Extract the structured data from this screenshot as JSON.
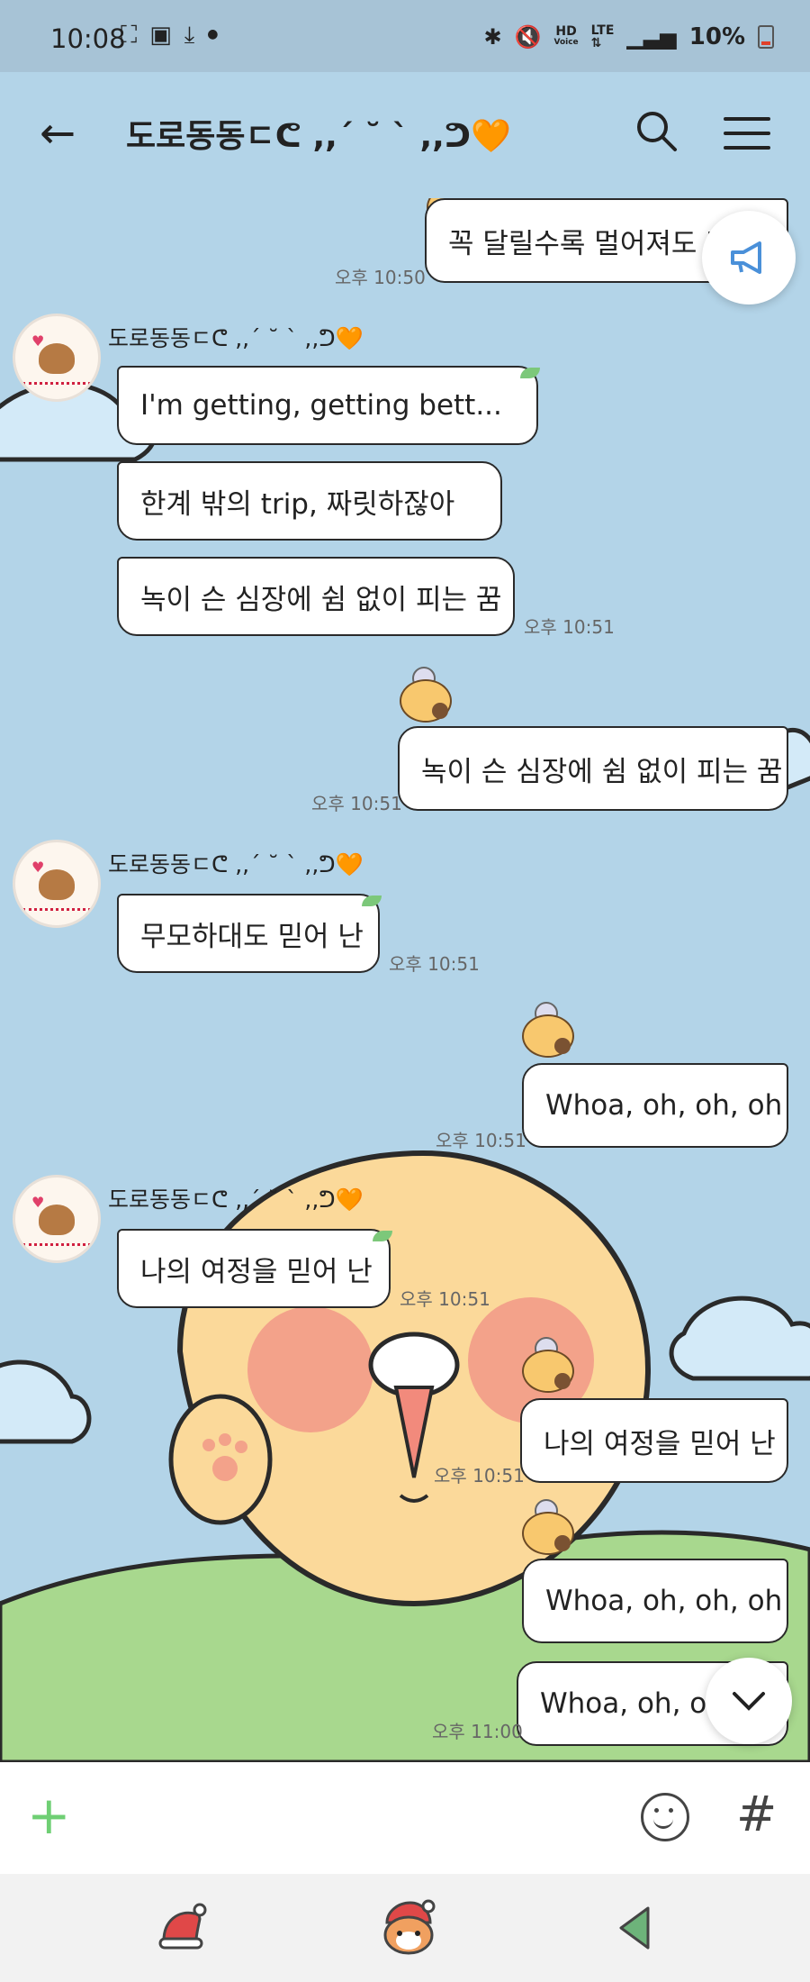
{
  "status_bar": {
    "time": "10:08",
    "icons_left": [
      "screenshot-icon",
      "image-icon",
      "download-icon",
      "dot-icon"
    ],
    "hd_label": "HD",
    "voice_label": "Voice",
    "lte_label": "LTE",
    "battery_text": "10%"
  },
  "header": {
    "title": "도로동동ㄷᕦ ,,ˊ ˘ ˋ ,,ᕤ🧡"
  },
  "messages": [
    {
      "id": "m0",
      "dir": "out",
      "text": "꼭 달릴수록 멀어져도 난",
      "time": "오후 10:50"
    },
    {
      "id": "m1",
      "dir": "in",
      "sender": "도로동동ㄷᕦ ,,ˊ ˘ ˋ ,,ᕤ🧡",
      "text": "I'm getting, getting bett...",
      "time": ""
    },
    {
      "id": "m2",
      "dir": "in",
      "text": "한계 밖의 trip, 짜릿하잖아",
      "time": ""
    },
    {
      "id": "m3",
      "dir": "in",
      "text": "녹이 슨 심장에 쉼 없이 피는 꿈",
      "time": "오후 10:51"
    },
    {
      "id": "m4",
      "dir": "out",
      "text": "녹이 슨 심장에 쉼 없이 피는 꿈",
      "time": "오후 10:51"
    },
    {
      "id": "m5",
      "dir": "in",
      "sender": "도로동동ㄷᕦ ,,ˊ ˘ ˋ ,,ᕤ🧡",
      "text": "무모하대도 믿어 난",
      "time": "오후 10:51"
    },
    {
      "id": "m6",
      "dir": "out",
      "text": "Whoa, oh, oh, oh",
      "time": "오후 10:51"
    },
    {
      "id": "m7",
      "dir": "in",
      "sender": "도로동동ㄷᕦ ,,ˊ ˘ ˋ ,,ᕤ🧡",
      "text": "나의 여정을 믿어 난",
      "time": "오후 10:51"
    },
    {
      "id": "m8",
      "dir": "out",
      "text": "나의 여정을 믿어 난",
      "time": "오후 10:51"
    },
    {
      "id": "m9",
      "dir": "out",
      "text": "Whoa, oh, oh, oh",
      "time": ""
    },
    {
      "id": "m10",
      "dir": "out",
      "text": "Whoa, oh, oh, oh",
      "time": "오후 11:00"
    }
  ],
  "input_bar": {
    "icons": [
      "plus-icon",
      "emoji-icon",
      "hashtag-icon"
    ],
    "hash_glyph": "#"
  },
  "nav_bar": {
    "icons": [
      "santa-hat-icon",
      "fox-santa-icon",
      "back-triangle-icon"
    ]
  },
  "colors": {
    "chat_background": "#b3d4e8",
    "accent_green": "#6fcf74",
    "announce_blue": "#4a90d9"
  }
}
